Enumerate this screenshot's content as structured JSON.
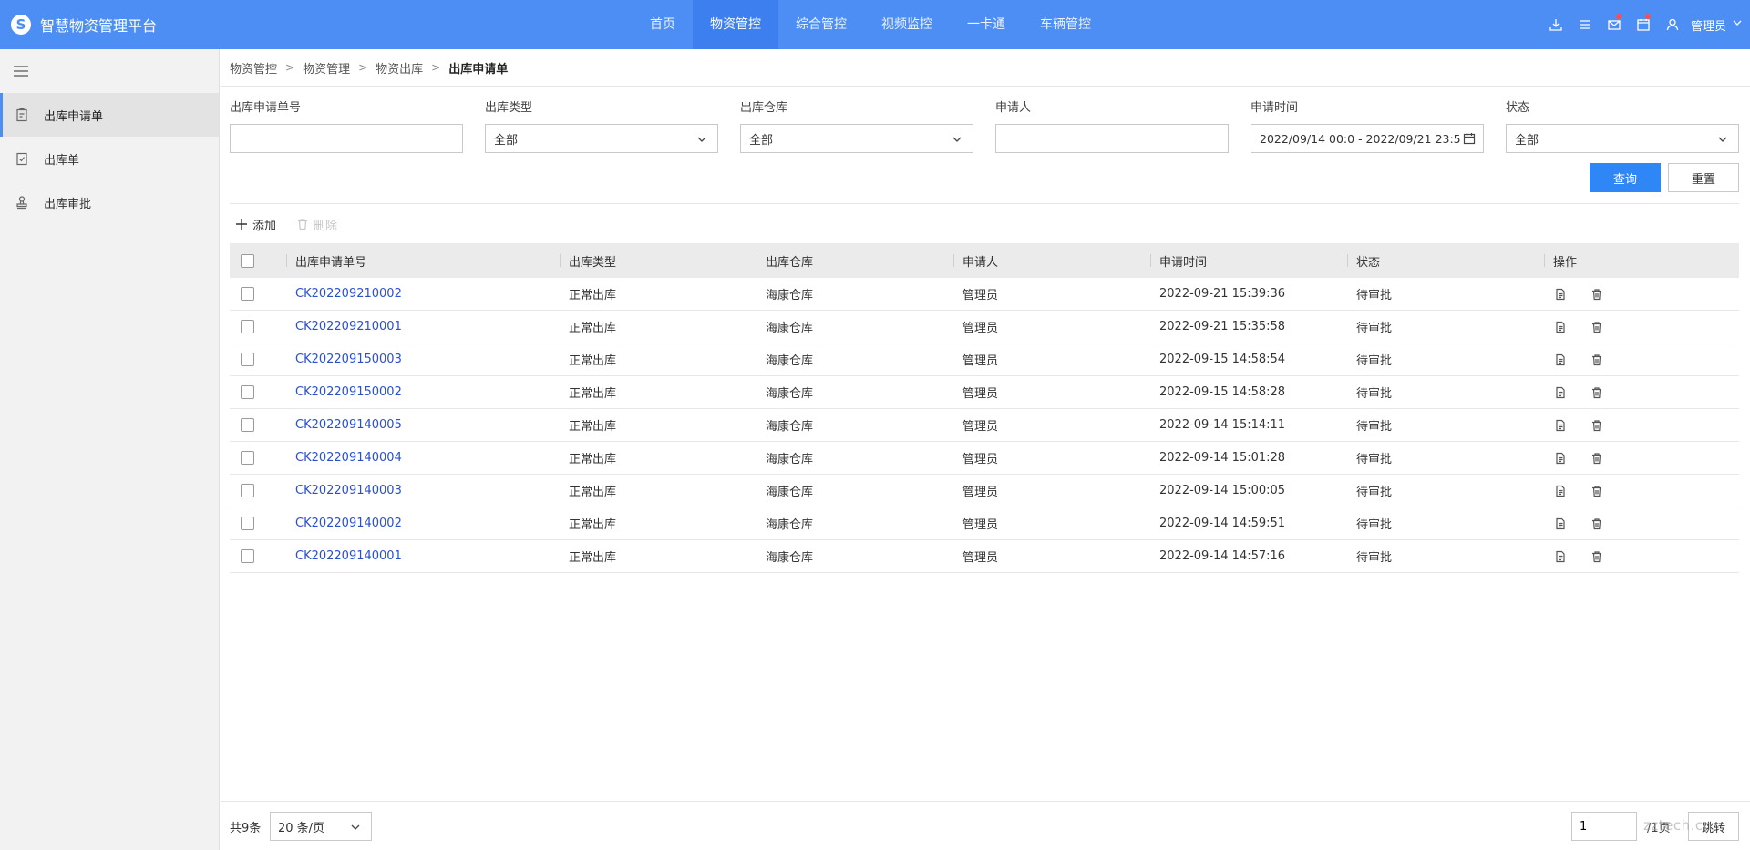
{
  "app": {
    "title": "智慧物资管理平台",
    "brand_color": "#4d8ef5"
  },
  "topnav": [
    {
      "label": "首页",
      "active": false
    },
    {
      "label": "物资管控",
      "active": true
    },
    {
      "label": "综合管控",
      "active": false
    },
    {
      "label": "视频监控",
      "active": false
    },
    {
      "label": "一卡通",
      "active": false
    },
    {
      "label": "车辆管控",
      "active": false
    }
  ],
  "top_actions": {
    "user_name": "管理员",
    "icons": [
      "download-icon",
      "list-icon",
      "mail-icon",
      "calendar-icon",
      "user-icon"
    ]
  },
  "sidebar": {
    "items": [
      {
        "label": "出库申请单",
        "icon": "clipboard-icon",
        "active": true
      },
      {
        "label": "出库单",
        "icon": "checklist-icon",
        "active": false
      },
      {
        "label": "出库审批",
        "icon": "stamp-icon",
        "active": false
      }
    ]
  },
  "breadcrumb": [
    "物资管控",
    "物资管理",
    "物资出库",
    "出库申请单"
  ],
  "filters": {
    "apply_no": {
      "label": "出库申请单号",
      "value": ""
    },
    "type": {
      "label": "出库类型",
      "value": "全部"
    },
    "warehouse": {
      "label": "出库仓库",
      "value": "全部"
    },
    "applicant": {
      "label": "申请人",
      "value": ""
    },
    "time": {
      "label": "申请时间",
      "value": "2022/09/14 00:0 - 2022/09/21 23:5"
    },
    "status": {
      "label": "状态",
      "value": "全部"
    }
  },
  "buttons": {
    "query": "查询",
    "reset": "重置",
    "add": "添加",
    "delete": "删除"
  },
  "table": {
    "headers": [
      "出库申请单号",
      "出库类型",
      "出库仓库",
      "申请人",
      "申请时间",
      "状态",
      "操作"
    ],
    "rows": [
      {
        "no": "CK202209210002",
        "type": "正常出库",
        "wh": "海康仓库",
        "app": "管理员",
        "time": "2022-09-21 15:39:36",
        "status": "待审批"
      },
      {
        "no": "CK202209210001",
        "type": "正常出库",
        "wh": "海康仓库",
        "app": "管理员",
        "time": "2022-09-21 15:35:58",
        "status": "待审批"
      },
      {
        "no": "CK202209150003",
        "type": "正常出库",
        "wh": "海康仓库",
        "app": "管理员",
        "time": "2022-09-15 14:58:54",
        "status": "待审批"
      },
      {
        "no": "CK202209150002",
        "type": "正常出库",
        "wh": "海康仓库",
        "app": "管理员",
        "time": "2022-09-15 14:58:28",
        "status": "待审批"
      },
      {
        "no": "CK202209140005",
        "type": "正常出库",
        "wh": "海康仓库",
        "app": "管理员",
        "time": "2022-09-14 15:14:11",
        "status": "待审批"
      },
      {
        "no": "CK202209140004",
        "type": "正常出库",
        "wh": "海康仓库",
        "app": "管理员",
        "time": "2022-09-14 15:01:28",
        "status": "待审批"
      },
      {
        "no": "CK202209140003",
        "type": "正常出库",
        "wh": "海康仓库",
        "app": "管理员",
        "time": "2022-09-14 15:00:05",
        "status": "待审批"
      },
      {
        "no": "CK202209140002",
        "type": "正常出库",
        "wh": "海康仓库",
        "app": "管理员",
        "time": "2022-09-14 14:59:51",
        "status": "待审批"
      },
      {
        "no": "CK202209140001",
        "type": "正常出库",
        "wh": "海康仓库",
        "app": "管理员",
        "time": "2022-09-14 14:57:16",
        "status": "待审批"
      }
    ]
  },
  "pager": {
    "total": "共9条",
    "page_size": "20 条/页",
    "page": "1",
    "page_suffix": "/1页",
    "jump": "跳转"
  },
  "watermark": "zztech.cn"
}
